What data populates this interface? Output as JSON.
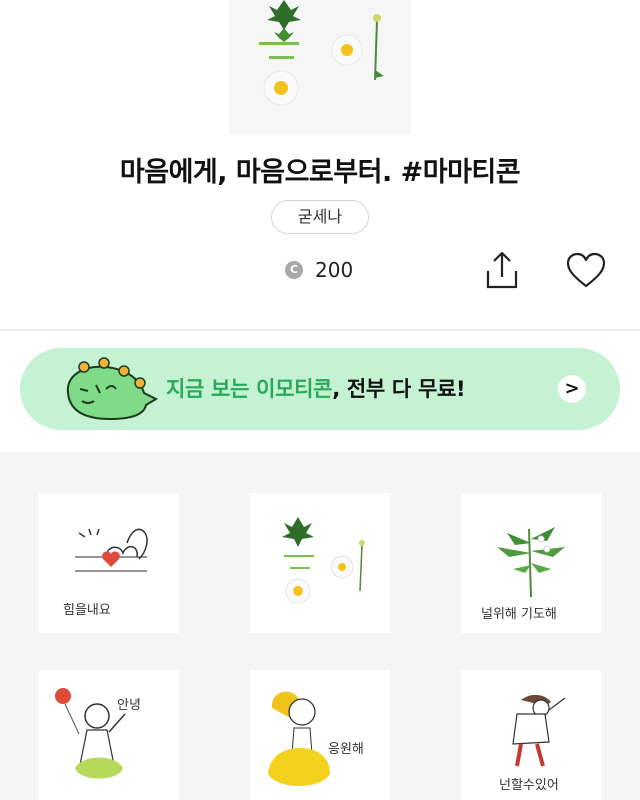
{
  "product": {
    "title": "마음에게, 마음으로부터. #마마티콘",
    "author": "굳세나",
    "coin_symbol": "C",
    "price": "200"
  },
  "actions": {
    "share_icon": "share-icon",
    "like_icon": "heart-icon"
  },
  "banner": {
    "text_highlight": "지금 보는 이모티콘",
    "text_rest": ", 전부 다 무료!",
    "arrow": ">",
    "background": "#c5f2d2",
    "accent": "#2aa85c"
  },
  "emoticons": [
    {
      "caption": "힘을내요"
    },
    {
      "caption": ""
    },
    {
      "caption": "널위해 기도해"
    },
    {
      "caption": "안녕"
    },
    {
      "caption": "응원해"
    },
    {
      "caption": "넌할수있어"
    }
  ]
}
